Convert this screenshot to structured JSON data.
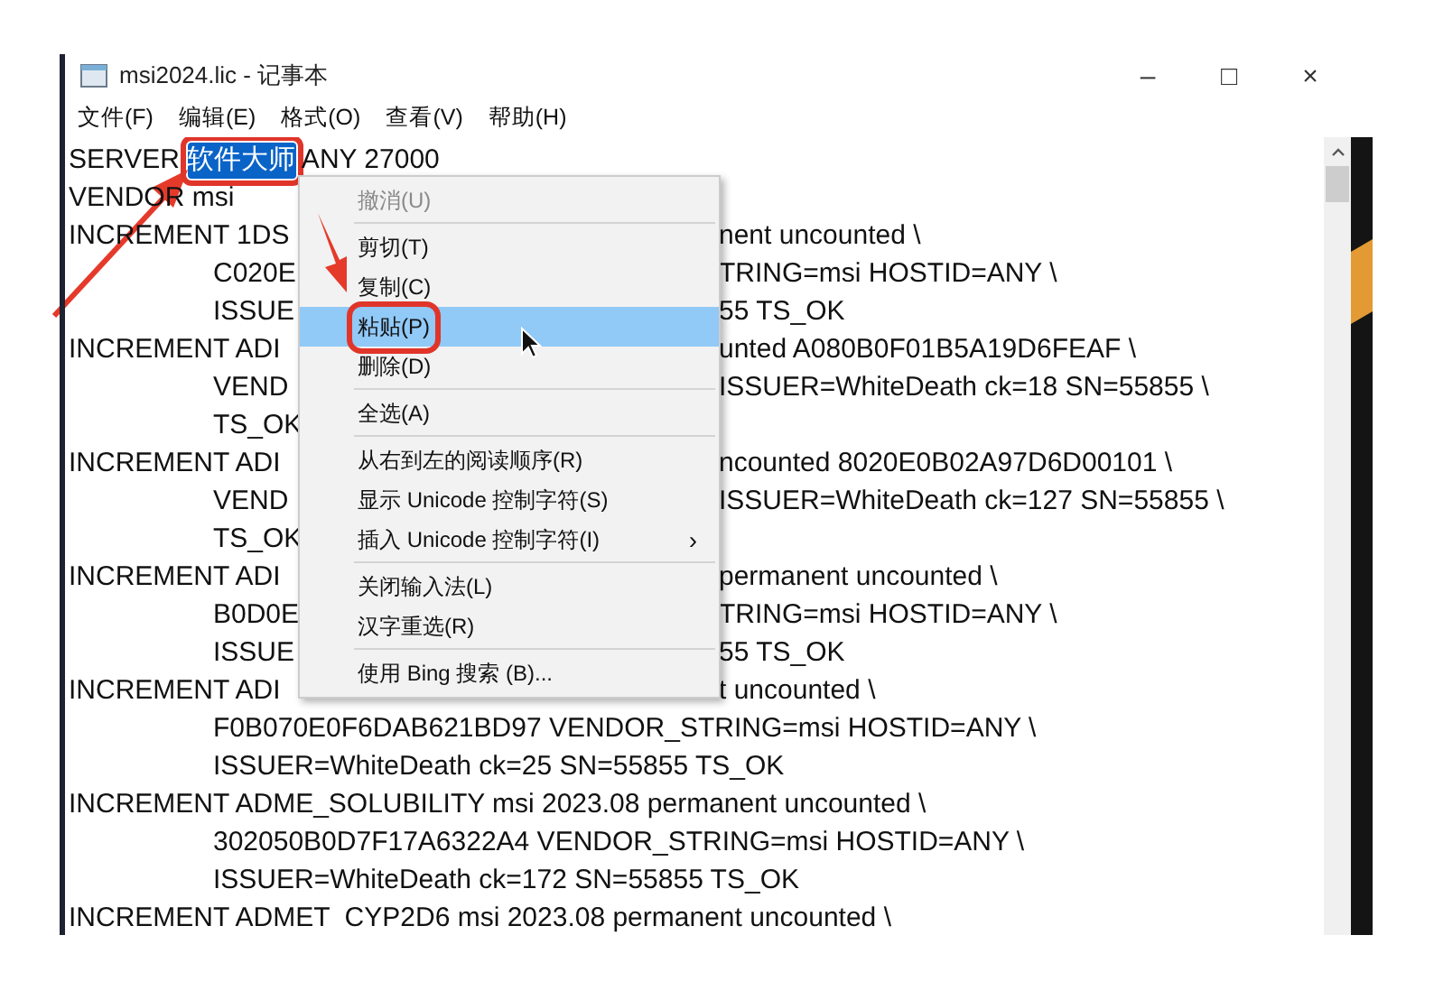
{
  "window": {
    "title": "msi2024.lic - 记事本",
    "controls": [
      "–",
      "□",
      "×"
    ]
  },
  "menu_bar": [
    {
      "label": "文件(F)"
    },
    {
      "label": "编辑(E)"
    },
    {
      "label": "格式(O)"
    },
    {
      "label": "查看(V)"
    },
    {
      "label": "帮助(H)"
    }
  ],
  "editor": {
    "lines": [
      {
        "segments": [
          {
            "text": "SERVER ",
            "selected": false,
            "outlined": false
          },
          {
            "text": "软件大师",
            "selected": true,
            "outlined": true
          },
          {
            "text": " ANY 27000",
            "selected": false,
            "outlined": false
          }
        ]
      },
      {
        "segments": [
          {
            "text": "VENDOR msi",
            "selected": false,
            "outlined": false
          }
        ]
      },
      {
        "segments": [
          {
            "text": "INCREMENT 1DS",
            "selected": false,
            "outlined": false
          }
        ],
        "right": "nent uncounted \\",
        "children": [
          {
            "segments": [
              {
                "text": "C020E",
                "selected": false,
                "outlined": false
              }
            ],
            "right": "TRING=msi HOSTID=ANY \\"
          },
          {
            "segments": [
              {
                "text": "ISSUE",
                "selected": false,
                "outlined": false
              }
            ],
            "right": "55 TS_OK"
          }
        ]
      },
      {
        "segments": [
          {
            "text": "INCREMENT ADI",
            "selected": false,
            "outlined": false
          }
        ],
        "right": "unted A080B0F01B5A19D6FEAF \\",
        "children": [
          {
            "segments": [
              {
                "text": "VEND",
                "selected": false,
                "outlined": false
              }
            ],
            "right": "ISSUER=WhiteDeath ck=18 SN=55855 \\"
          },
          {
            "segments": [
              {
                "text": "TS_OK",
                "selected": false,
                "outlined": false
              }
            ]
          }
        ]
      },
      {
        "segments": [
          {
            "text": "INCREMENT ADI",
            "selected": false,
            "outlined": false
          }
        ],
        "right": "ncounted 8020E0B02A97D6D00101 \\",
        "children": [
          {
            "segments": [
              {
                "text": "VEND",
                "selected": false,
                "outlined": false
              }
            ],
            "right": "ISSUER=WhiteDeath ck=127 SN=55855 \\"
          },
          {
            "segments": [
              {
                "text": "TS_OK",
                "selected": false,
                "outlined": false
              }
            ]
          }
        ]
      },
      {
        "segments": [
          {
            "text": "INCREMENT ADI",
            "selected": false,
            "outlined": false
          }
        ],
        "right": "permanent uncounted \\",
        "children": [
          {
            "segments": [
              {
                "text": "B0D0E",
                "selected": false,
                "outlined": false
              }
            ],
            "right": "TRING=msi HOSTID=ANY \\"
          },
          {
            "segments": [
              {
                "text": "ISSUE",
                "selected": false,
                "outlined": false
              }
            ],
            "right": "55 TS_OK"
          }
        ]
      },
      {
        "segments": [
          {
            "text": "INCREMENT ADI",
            "selected": false,
            "outlined": false
          }
        ],
        "right": "t uncounted \\",
        "children": [
          {
            "segments": [
              {
                "text": "F0B070E0F6DAB621BD97 VENDOR_STRING=msi HOSTID=ANY \\",
                "selected": false,
                "outlined": false
              }
            ]
          },
          {
            "segments": [
              {
                "text": "ISSUER=WhiteDeath ck=25 SN=55855 TS_OK",
                "selected": false,
                "outlined": false
              }
            ]
          }
        ]
      },
      {
        "segments": [
          {
            "text": "INCREMENT ADME_SOLUBILITY msi 2023.08 permanent uncounted \\",
            "selected": false,
            "outlined": false
          }
        ],
        "children": [
          {
            "segments": [
              {
                "text": "302050B0D7F17A6322A4 VENDOR_STRING=msi HOSTID=ANY \\",
                "selected": false,
                "outlined": false
              }
            ]
          },
          {
            "segments": [
              {
                "text": "ISSUER=WhiteDeath ck=172 SN=55855 TS_OK",
                "selected": false,
                "outlined": false
              }
            ]
          }
        ]
      },
      {
        "segments": [
          {
            "text": "INCREMENT ADMET  CYP2D6 msi 2023.08 permanent uncounted \\",
            "selected": false,
            "outlined": false
          }
        ]
      }
    ]
  },
  "context_menu": [
    {
      "kind": "item",
      "label": "撤消(U)",
      "disabled": true,
      "selected": false,
      "outlined": false
    },
    {
      "kind": "separator"
    },
    {
      "kind": "item",
      "label": "剪切(T)",
      "disabled": false,
      "selected": false,
      "outlined": false
    },
    {
      "kind": "item",
      "label": "复制(C)",
      "disabled": false,
      "selected": false,
      "outlined": false
    },
    {
      "kind": "item",
      "label": "粘贴(P)",
      "disabled": false,
      "selected": true,
      "outlined": true
    },
    {
      "kind": "item",
      "label": "删除(D)",
      "disabled": false,
      "selected": false,
      "outlined": false
    },
    {
      "kind": "separator"
    },
    {
      "kind": "item",
      "label": "全选(A)",
      "disabled": false,
      "selected": false,
      "outlined": false
    },
    {
      "kind": "separator"
    },
    {
      "kind": "item",
      "label": "从右到左的阅读顺序(R)",
      "disabled": false,
      "selected": false,
      "outlined": false
    },
    {
      "kind": "item",
      "label": "显示 Unicode 控制字符(S)",
      "disabled": false,
      "selected": false,
      "outlined": false
    },
    {
      "kind": "item",
      "label": "插入 Unicode 控制字符(I)",
      "disabled": false,
      "selected": false,
      "outlined": false,
      "arrow": "›"
    },
    {
      "kind": "separator"
    },
    {
      "kind": "item",
      "label": "关闭输入法(L)",
      "disabled": false,
      "selected": false,
      "outlined": false
    },
    {
      "kind": "item",
      "label": "汉字重选(R)",
      "disabled": false,
      "selected": false,
      "outlined": false
    },
    {
      "kind": "separator"
    },
    {
      "kind": "item",
      "label": "使用 Bing 搜索 (B)...",
      "disabled": false,
      "selected": false,
      "outlined": false
    }
  ]
}
